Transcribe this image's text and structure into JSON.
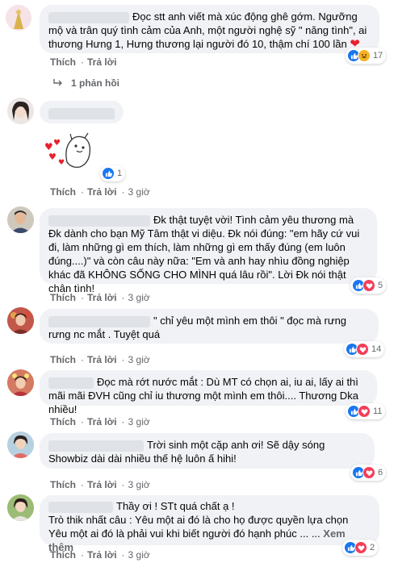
{
  "comments": [
    {
      "text": "Đọc stt anh viết mà xúc động ghê gớm. Ngưỡng mộ và trân quý tình cảm của Anh, một người nghệ sỹ \" năng tình\", ai thương Hưng 1, Hưng thương lại người đó 10, thậm chí 100 lần",
      "reaction_count": "17",
      "actions": {
        "like": "Thích",
        "reply": "Trả lời",
        "time": "3 giờ"
      },
      "replies_label": "1 phản hồi"
    },
    {
      "reaction_count": "1",
      "actions": {
        "like": "Thích",
        "reply": "Trả lời",
        "time": "3 giờ"
      }
    },
    {
      "text": "Đk thật tuyệt vời! Tình cảm yêu thương mà Đk dành cho bạn Mỹ Tâm thật vi diệu. Đk nói đúng: \"em hãy cứ vui đi, làm những gì em thích, làm những gì em thấy đúng (em luôn đúng....)\" và còn câu này nữa: \"Em và anh hay nhìu đồng nghiệp khác đã KHÔNG SỐNG CHO MÌNH quá lâu rồi\". Lời Đk nói thật chân tình!",
      "reaction_count": "5",
      "actions": {
        "like": "Thích",
        "reply": "Trả lời",
        "time": "3 giờ"
      }
    },
    {
      "text": "\" chỉ yêu một mình em thôi \" đọc mà rưng rưng nc mắt . Tuyệt quá",
      "reaction_count": "14",
      "actions": {
        "like": "Thích",
        "reply": "Trả lời",
        "time": "3 giờ"
      }
    },
    {
      "text": "Đọc mà rớt nước mắt : Dù MT có chọn ai, iu ai, lấy ai thì mãi mãi ĐVH cũng chỉ iu thương một mình em thôi.... Thương Dka nhiều!",
      "reaction_count": "11",
      "actions": {
        "like": "Thích",
        "reply": "Trả lời",
        "time": "3 giờ"
      }
    },
    {
      "text": "Trời sinh một cặp anh ơi! Sẽ dậy sóng Showbiz dài dài nhiều thế hệ luôn ấ hihi!",
      "reaction_count": "6",
      "actions": {
        "like": "Thích",
        "reply": "Trả lời",
        "time": "3 giờ"
      }
    },
    {
      "text_line1": "Thầy ơi ! STt quá chất ạ !",
      "text_line2": "Trò thik nhất câu : Yêu một ai đó là cho họ được quyền lựa chọn",
      "text_line3": "Yêu một ai đó là phải vui khi biết người đó hạnh phúc ... ...",
      "see_more": "Xem thêm",
      "reaction_count": "2",
      "actions": {
        "like": "Thích",
        "reply": "Trả lời",
        "time": "3 giờ"
      }
    }
  ],
  "colors": {
    "like": "#1877f2",
    "love": "#f33e58",
    "haha": "#f7b125",
    "bubble": "#f0f2f5",
    "meta": "#65676b"
  }
}
